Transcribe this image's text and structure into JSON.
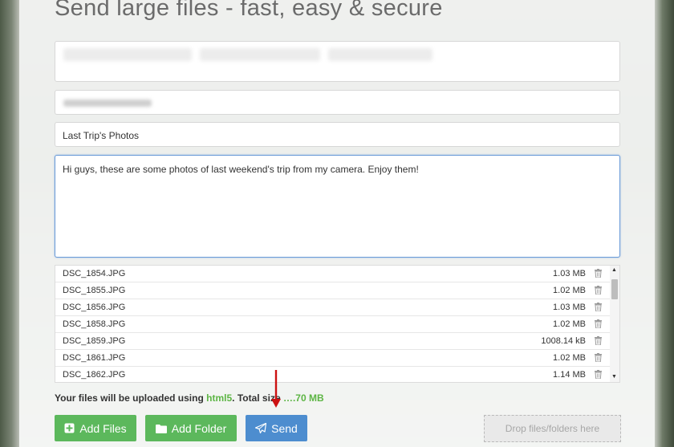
{
  "header": {
    "title": "Send large files - fast, easy & secure"
  },
  "form": {
    "subject": "Last Trip's Photos",
    "message": "Hi guys, these are some photos of last weekend's trip from my camera. Enjoy them!"
  },
  "files": [
    {
      "name": "DSC_1854.JPG",
      "size": "1.03 MB"
    },
    {
      "name": "DSC_1855.JPG",
      "size": "1.02 MB"
    },
    {
      "name": "DSC_1856.JPG",
      "size": "1.03 MB"
    },
    {
      "name": "DSC_1858.JPG",
      "size": "1.02 MB"
    },
    {
      "name": "DSC_1859.JPG",
      "size": "1008.14 kB"
    },
    {
      "name": "DSC_1861.JPG",
      "size": "1.02 MB"
    },
    {
      "name": "DSC_1862.JPG",
      "size": "1.14 MB"
    }
  ],
  "status": {
    "prefix": "Your files will be uploaded using ",
    "method": "html5",
    "middle": ". Total size ",
    "total": "….70 MB"
  },
  "buttons": {
    "add_files": "Add Files",
    "add_folder": "Add Folder",
    "send": "Send"
  },
  "drop_zone": {
    "label": "Drop files/folders here"
  },
  "colors": {
    "green_button": "#5cb85c",
    "send_button": "#4d8dcf",
    "status_green": "#5cb544",
    "arrow": "#cc1111"
  },
  "icons": {
    "add_files": "plus-square-icon",
    "add_folder": "folder-icon",
    "send": "paper-plane-icon",
    "file_delete": "trash-icon"
  }
}
